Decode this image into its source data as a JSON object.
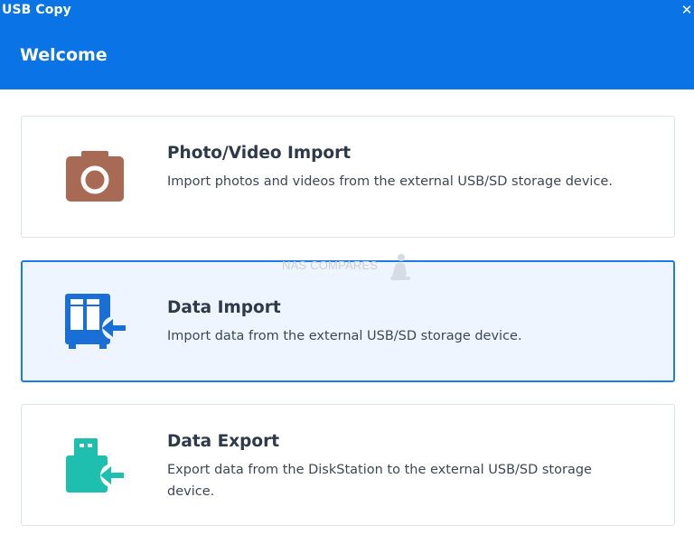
{
  "window": {
    "title": "USB Copy",
    "close_glyph": "✕"
  },
  "page": {
    "heading": "Welcome"
  },
  "options": [
    {
      "title": "Photo/Video Import",
      "description": "Import photos and videos from the external USB/SD storage device.",
      "icon": "camera-icon",
      "icon_color": "#a86a54",
      "selected": false
    },
    {
      "title": "Data Import",
      "description": "Import data from the external USB/SD storage device.",
      "icon": "nas-import-icon",
      "icon_color": "#1a6fd6",
      "selected": true
    },
    {
      "title": "Data Export",
      "description": "Export data from the DiskStation to the external USB/SD storage device.",
      "icon": "usb-export-icon",
      "icon_color": "#1fbfb0",
      "selected": false
    }
  ],
  "watermark": {
    "text": "NAS COMPARES"
  },
  "colors": {
    "header_bg": "#0a73e5",
    "selected_border": "#1c7be5",
    "selected_bg": "#eef5ff"
  }
}
